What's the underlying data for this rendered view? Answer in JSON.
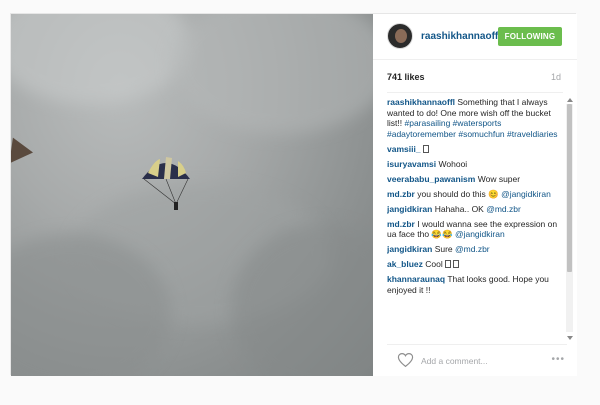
{
  "post": {
    "username": "raashikhannaoffl",
    "follow_label": "FOLLOWING",
    "likes": "741 likes",
    "time": "1d",
    "add_comment_placeholder": "Add a comment...",
    "more_label": "•••"
  },
  "comments": [
    {
      "user": "raashikhannaoffl",
      "text": " Something that I always wanted to do! One more wish off the bucket list!! ",
      "tags": "#parasailing #watersports #adaytoremember #somuchfun #traveldiaries"
    },
    {
      "user": "vamsiii_",
      "text": "",
      "glyph": true
    },
    {
      "user": "isuryavamsi",
      "text": " Wohooi"
    },
    {
      "user": "veerababu_pawanism",
      "text": " Wow super"
    },
    {
      "user": "md.zbr",
      "text": " you should do this 😊 ",
      "tags": "@jangidkiran"
    },
    {
      "user": "jangidkiran",
      "text": " Hahaha.. OK ",
      "tags": "@md.zbr"
    },
    {
      "user": "md.zbr",
      "text": " I would wanna see the expression on ua face tho 😂😂 ",
      "tags": "@jangidkiran"
    },
    {
      "user": "jangidkiran",
      "text": " Sure ",
      "tags": "@md.zbr"
    },
    {
      "user": "ak_bluez",
      "text": " Cool",
      "glyph": true,
      "glyph2": true
    },
    {
      "user": "khannaraunaq",
      "text": " That looks good. Hope you enjoyed it !!"
    }
  ],
  "colors": {
    "follow_bg": "#6bbd4d",
    "link": "#125688"
  },
  "icons": {
    "heart": "heart-outline-icon",
    "more": "ellipsis-icon"
  }
}
